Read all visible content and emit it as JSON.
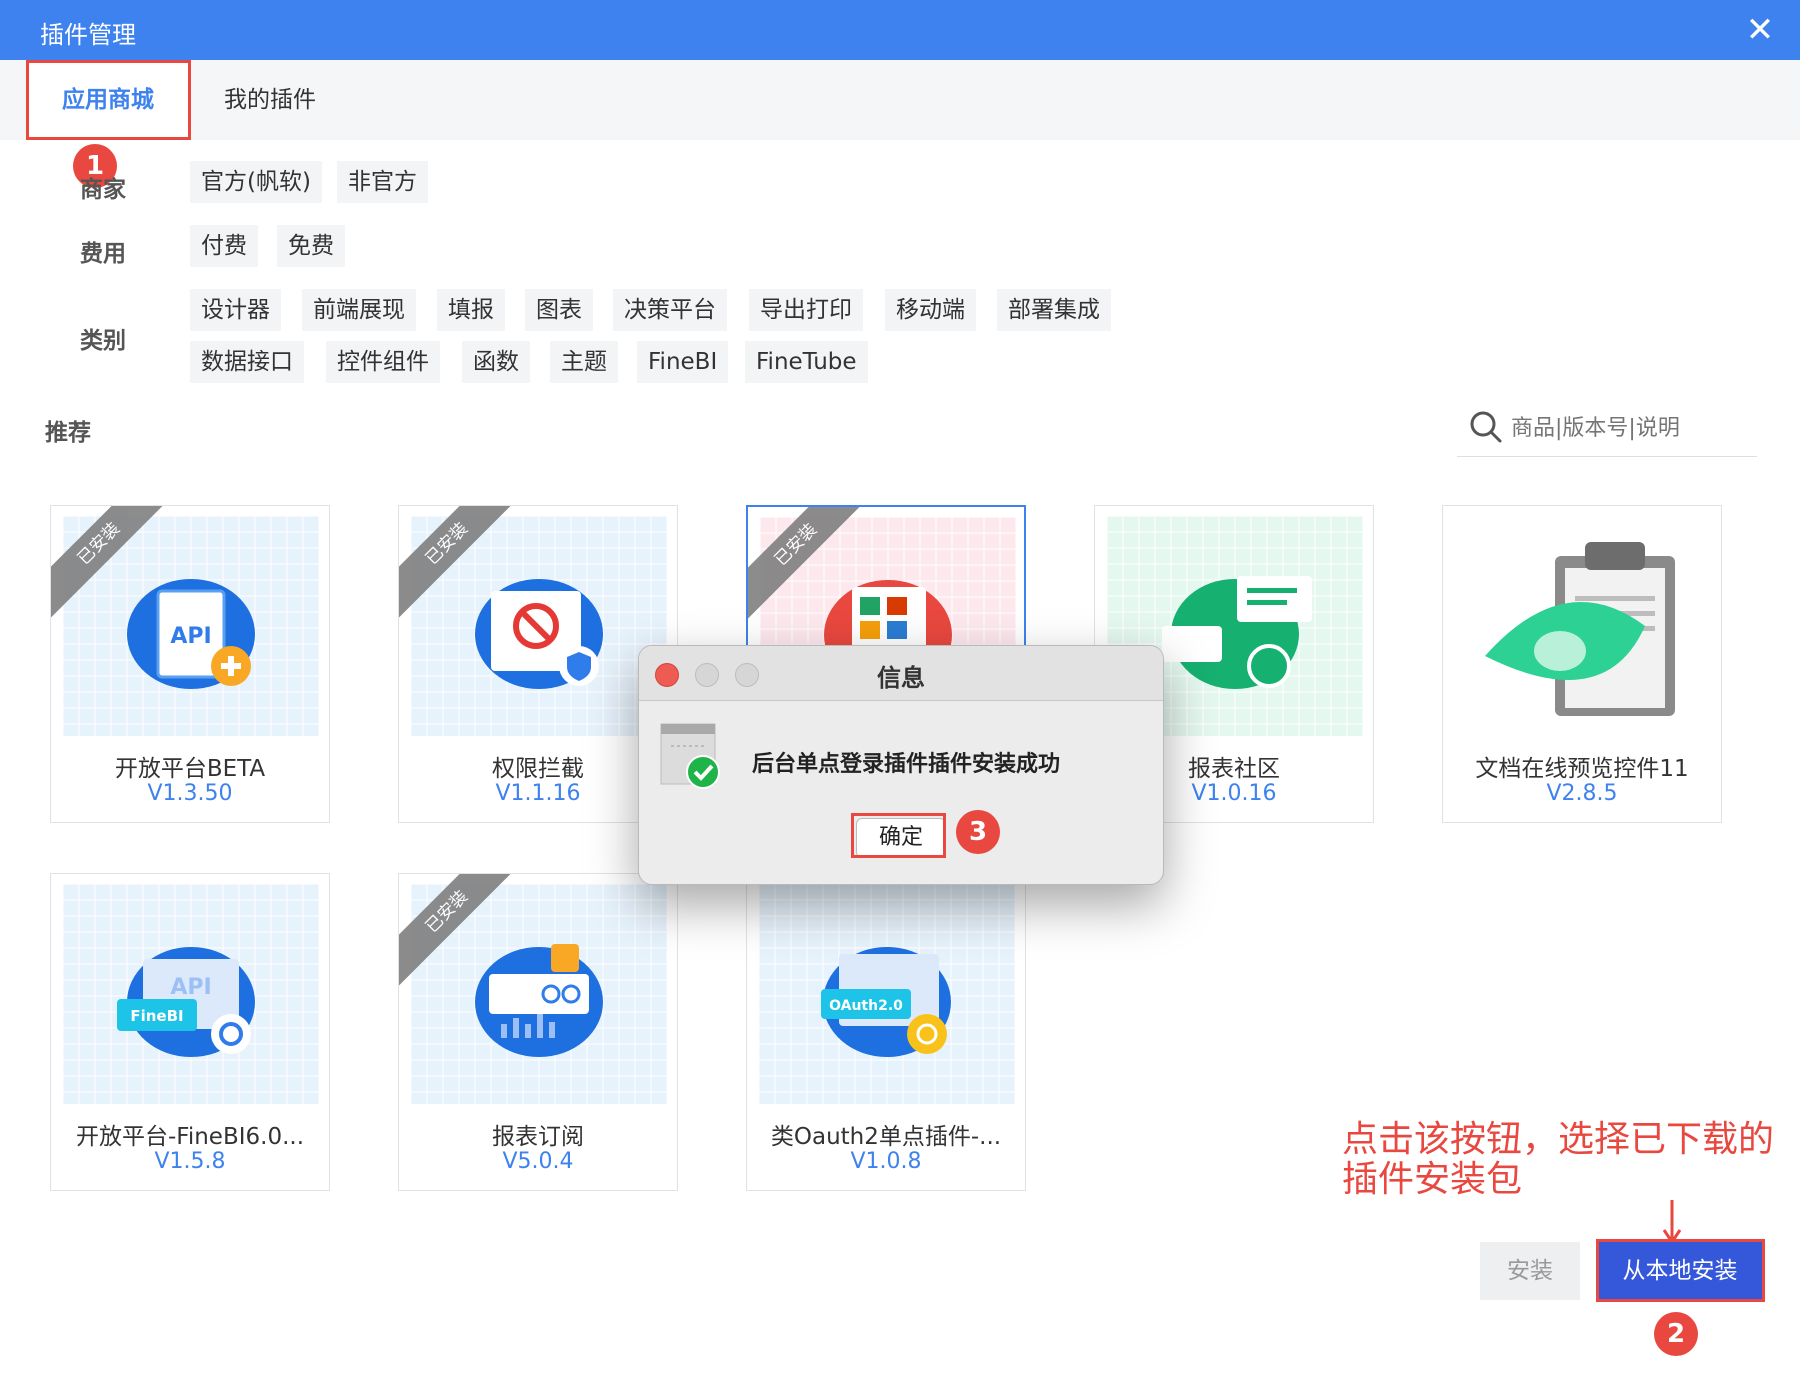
{
  "window": {
    "title": "插件管理",
    "close_icon": "close-icon"
  },
  "tabs": [
    {
      "label": "应用商城",
      "active": true
    },
    {
      "label": "我的插件",
      "active": false
    }
  ],
  "filters": {
    "vendor": {
      "label": "商家",
      "chips": [
        "官方(帆软)",
        "非官方"
      ]
    },
    "fee": {
      "label": "费用",
      "chips": [
        "付费",
        "免费"
      ]
    },
    "category": {
      "label": "类别",
      "chips": [
        "设计器",
        "前端展现",
        "填报",
        "图表",
        "决策平台",
        "导出打印",
        "移动端",
        "部署集成",
        "数据接口",
        "控件组件",
        "函数",
        "主题",
        "FineBI",
        "FineTube"
      ]
    }
  },
  "section": {
    "label": "推荐"
  },
  "search": {
    "placeholder": "商品|版本号|说明",
    "icon": "search-icon"
  },
  "plugins": [
    {
      "name": "开放平台BETA",
      "version": "V1.3.50",
      "installed": true,
      "ribbon": "已安装",
      "icon": "api-plus-icon"
    },
    {
      "name": "权限拦截",
      "version": "V1.1.16",
      "installed": true,
      "ribbon": "已安装",
      "icon": "block-shield-icon"
    },
    {
      "name": "",
      "version": "",
      "installed": true,
      "ribbon": "已安装",
      "icon": "office-files-icon"
    },
    {
      "name": "报表社区",
      "version": "V1.0.16",
      "installed": false,
      "ribbon": "",
      "icon": "chat-community-icon"
    },
    {
      "name": "文档在线预览控件11",
      "version": "V2.8.5",
      "installed": false,
      "ribbon": "",
      "icon": "document-eye-icon"
    },
    {
      "name": "开放平台-FineBI6.0...",
      "version": "V1.5.8",
      "installed": false,
      "ribbon": "",
      "icon": "finebi-api-icon"
    },
    {
      "name": "报表订阅",
      "version": "V5.0.4",
      "installed": true,
      "ribbon": "已安装",
      "icon": "subscription-icon"
    },
    {
      "name": "类Oauth2单点插件-...",
      "version": "V1.0.8",
      "installed": false,
      "ribbon": "",
      "icon": "oauth2-icon"
    }
  ],
  "annotation": {
    "text": "点击该按钮，选择已下载的插件安装包",
    "badges": [
      "1",
      "2",
      "3"
    ]
  },
  "buttons": {
    "install": "安装",
    "local_install": "从本地安装"
  },
  "dialog": {
    "title": "信息",
    "message": "后台单点登录插件插件安装成功",
    "ok": "确定"
  },
  "colors": {
    "primary": "#3d82ee",
    "annotation_red": "#e8483f",
    "local_button": "#3557d9"
  }
}
